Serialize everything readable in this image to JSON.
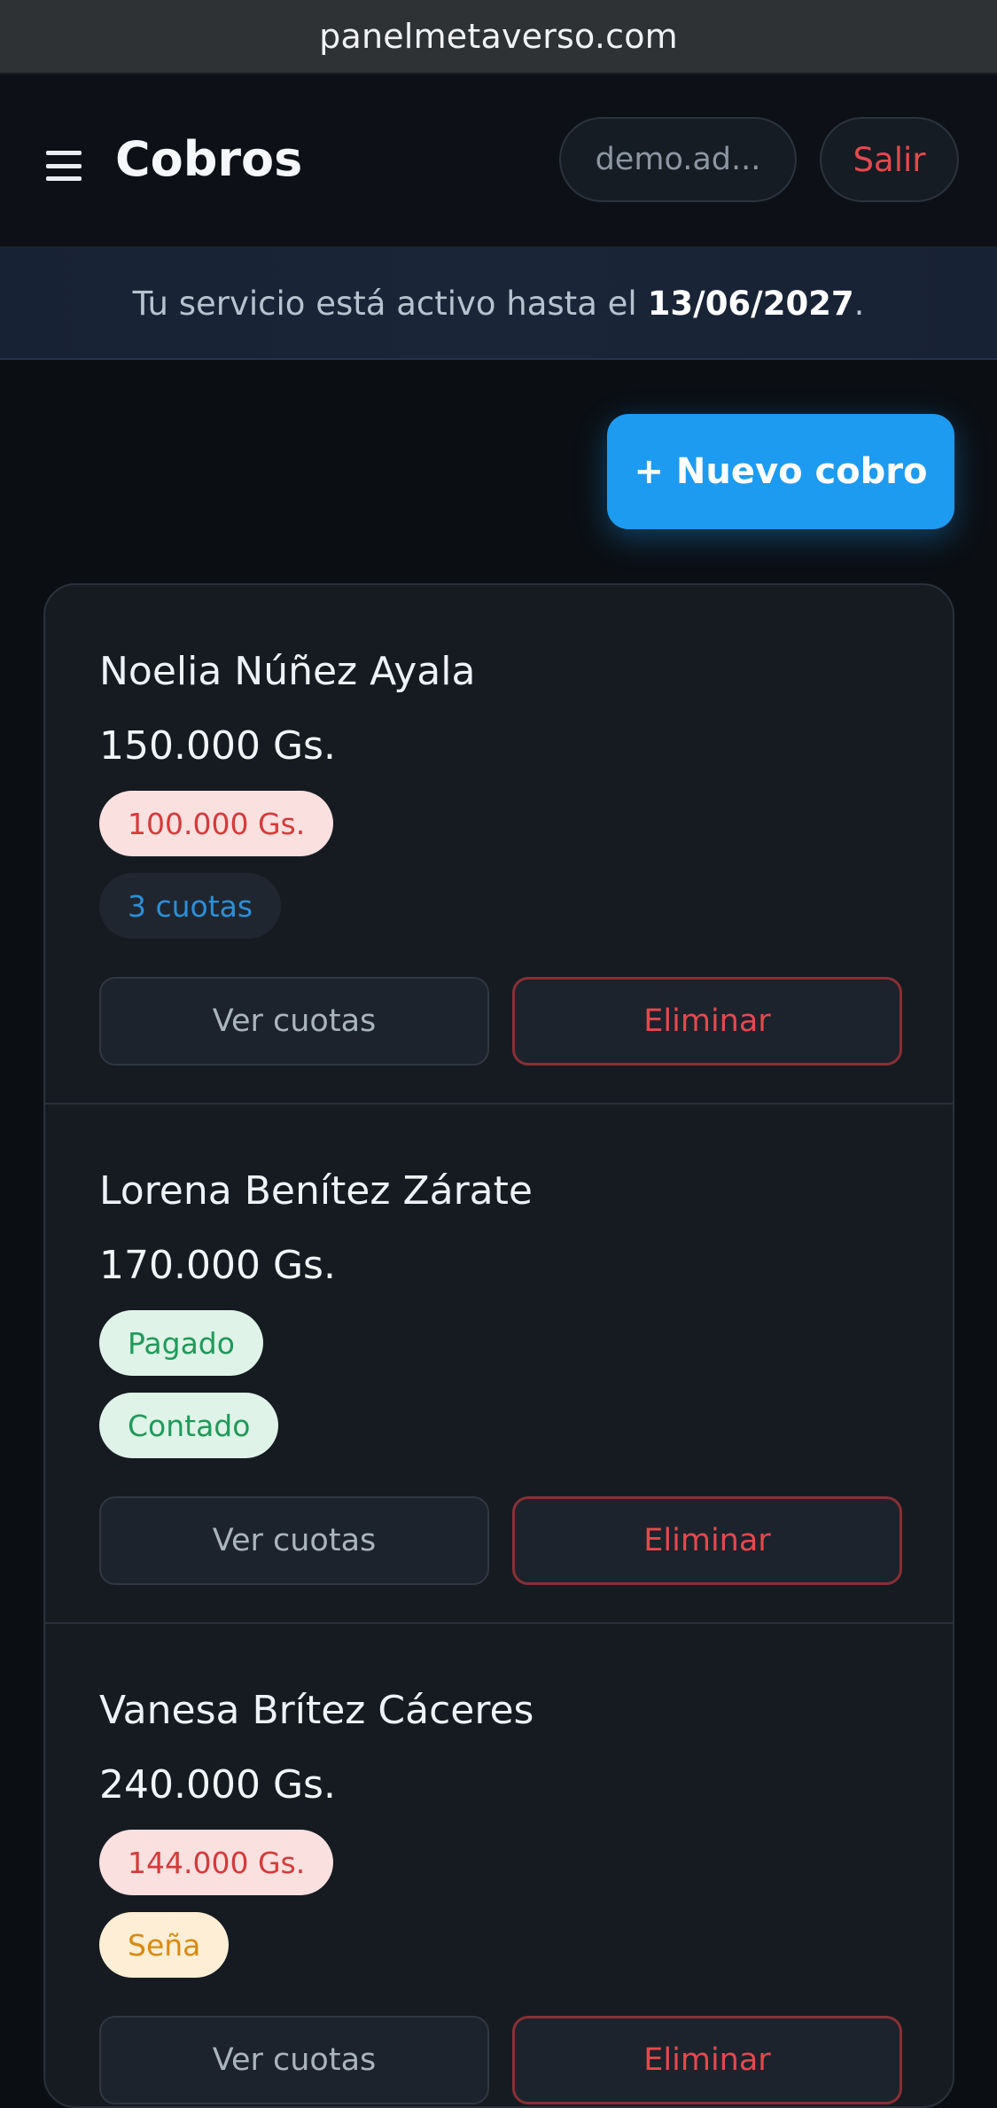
{
  "browser": {
    "url": "panelmetaverso.com"
  },
  "header": {
    "title": "Cobros",
    "user_label": "demo.ad...",
    "logout_label": "Salir"
  },
  "banner": {
    "text": "Tu servicio está activo hasta el",
    "date": "13/06/2027",
    "suffix": "."
  },
  "actions": {
    "new_label": "+ Nuevo cobro"
  },
  "items": [
    {
      "name": "Noelia Núñez Ayala",
      "amount": "150.000 Gs.",
      "badge_1": "100.000 Gs.",
      "badge_2": "3 cuotas",
      "view_label": "Ver cuotas",
      "delete_label": "Eliminar"
    },
    {
      "name": "Lorena Benítez Zárate",
      "amount": "170.000 Gs.",
      "badge_1": "Pagado",
      "badge_2": "Contado",
      "view_label": "Ver cuotas",
      "delete_label": "Eliminar"
    },
    {
      "name": "Vanesa Brítez Cáceres",
      "amount": "240.000 Gs.",
      "badge_1": "144.000 Gs.",
      "badge_2": "Seña",
      "view_label": "Ver cuotas",
      "delete_label": "Eliminar"
    }
  ],
  "colors": {
    "accent": "#1d9bf0",
    "danger": "#e5484d",
    "success": "#1f9a5a",
    "warning": "#d98a12",
    "background": "#0b0f14",
    "card": "#161b22"
  }
}
